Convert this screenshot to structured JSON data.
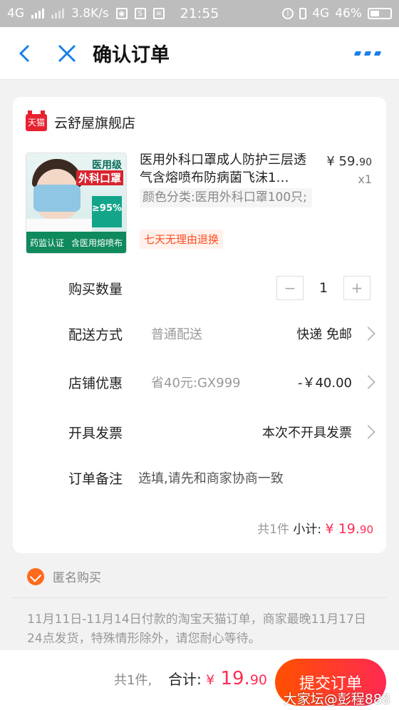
{
  "status_bar": {
    "network_left": "4G",
    "speed": "3.8K/s",
    "time": "21:55",
    "network_right": "4G",
    "battery": "46%"
  },
  "header": {
    "title": "确认订单"
  },
  "store": {
    "logo_text": "天猫",
    "name": "云舒屋旗舰店"
  },
  "product": {
    "title": "医用外科口罩成人防护三层透气含熔喷布防病菌飞沫1…",
    "price_symbol": "¥",
    "price_int": "59.",
    "price_dec": "90",
    "quantity": "x1",
    "spec": "颜色分类:医用外科口罩100只;",
    "tag": "七天无理由退换",
    "image": {
      "label1": "医用级",
      "label2": "外科口罩",
      "label3": "≥95%",
      "band_left": "药监认证",
      "band_right": "含医用熔喷布"
    }
  },
  "rows": {
    "qty_label": "购买数量",
    "qty_value": "1",
    "delivery_label": "配送方式",
    "delivery_sub": "普通配送",
    "delivery_value": "快递 免邮",
    "coupon_label": "店铺优惠",
    "coupon_sub": "省40元:GX999",
    "coupon_value": "-￥40.00",
    "invoice_label": "开具发票",
    "invoice_value": "本次不开具发票",
    "note_label": "订单备注",
    "note_placeholder": "选填,请先和商家协商一致"
  },
  "subtotal": {
    "count": "共1件",
    "label": "小计:",
    "symbol": "¥",
    "int": "19.",
    "dec": "90"
  },
  "anonymous": {
    "label": "匿名购买"
  },
  "notice": "11月11日-11月14日付款的淘宝天猫订单，商家最晚11月17日24点发货，特殊情形除外，请您耐心等待。",
  "bottom": {
    "count": "共1件,",
    "total_label": "合计:",
    "symbol": "¥",
    "int": "19.",
    "dec": "90",
    "submit": "提交订单"
  },
  "watermark": "大家坛@彭程888",
  "colors": {
    "accent": "#ff5000",
    "price": "#ff2d55",
    "link": "#1a7fe8"
  }
}
